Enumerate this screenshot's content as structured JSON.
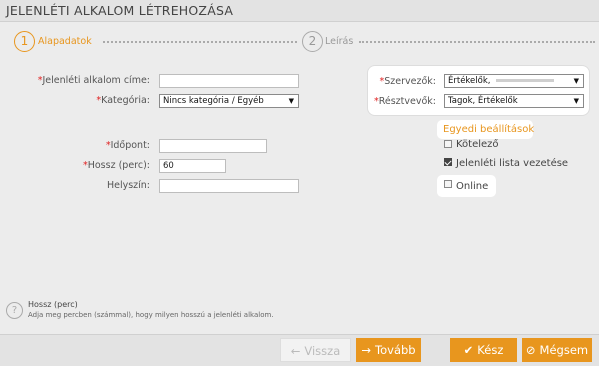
{
  "window": {
    "title": "JELENLÉTI ALKALOM LÉTREHOZÁSA"
  },
  "steps": [
    {
      "number": "1",
      "label": "Alapadatok",
      "active": true
    },
    {
      "number": "2",
      "label": "Leírás",
      "active": false
    }
  ],
  "form": {
    "required_mark": "*",
    "title_label": "Jelenléti alkalom címe:",
    "title_value": "",
    "category_label": "Kategória:",
    "category_value": "Nincs kategória / Egyéb",
    "time_label": "Időpont:",
    "time_value": "",
    "duration_label": "Hossz (perc):",
    "duration_value": "60",
    "location_label": "Helyszín:",
    "location_value": ""
  },
  "side": {
    "organizers_label": "Szervezők:",
    "organizers_value": "Értékelők,",
    "participants_label": "Résztvevők:",
    "participants_value": "Tagok, Értékelők"
  },
  "custom_settings": {
    "title": "Egyedi beállítások",
    "options": [
      {
        "label": "Kötelező",
        "checked": false
      },
      {
        "label": "Jelenléti lista vezetése",
        "checked": true
      },
      {
        "label": "Online",
        "checked": false
      }
    ]
  },
  "help": {
    "icon": "?",
    "title": "Hossz (perc)",
    "text": "Adja meg percben (számmal), hogy milyen hosszú a jelenléti alkalom."
  },
  "footer": {
    "back_icon": "←",
    "back_label": "Vissza",
    "next_icon": "→",
    "next_label": "Tovább",
    "done_icon": "✔",
    "done_label": "Kész",
    "cancel_icon": "⊘",
    "cancel_label": "Mégsem"
  },
  "colors": {
    "accent": "#e8961e",
    "required": "#e02020",
    "panel": "#ececec",
    "bar": "#e3e3e3"
  }
}
